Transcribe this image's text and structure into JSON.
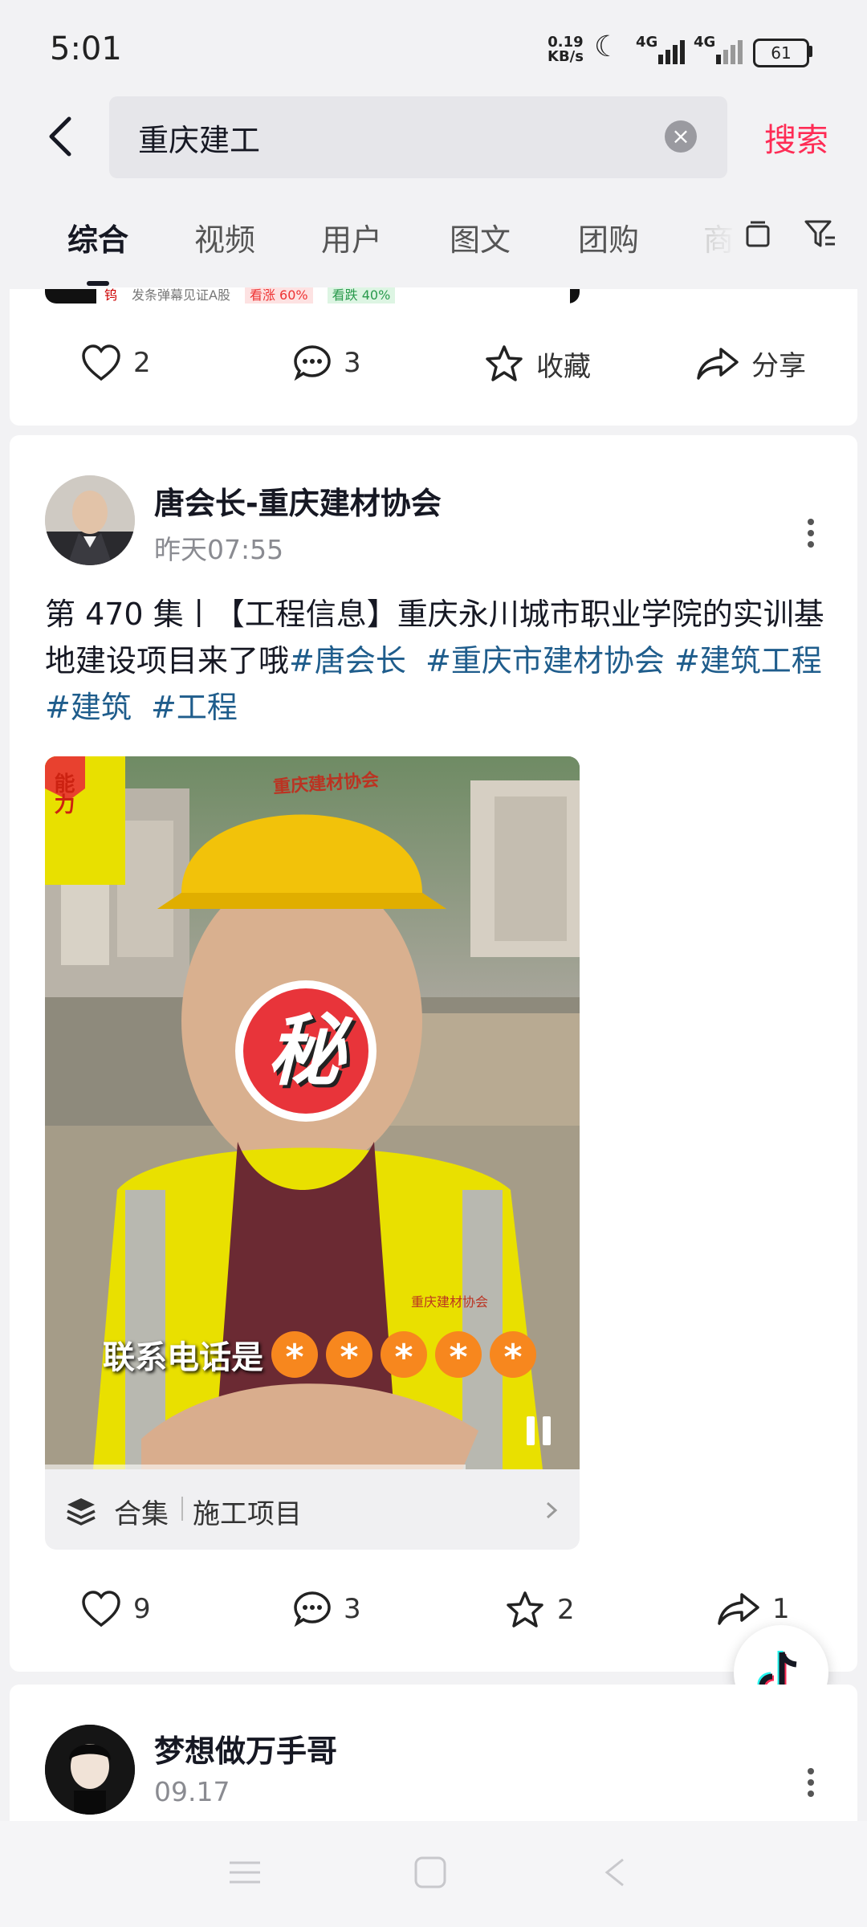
{
  "status_bar": {
    "time": "5:01",
    "net_speed_value": "0.19",
    "net_speed_unit": "KB/s",
    "signal1": "4G",
    "signal2": "4G",
    "battery": "61"
  },
  "search": {
    "query": "重庆建工",
    "search_label": "搜索"
  },
  "tabs": [
    {
      "label": "综合",
      "active": true
    },
    {
      "label": "视频"
    },
    {
      "label": "用户"
    },
    {
      "label": "图文"
    },
    {
      "label": "团购"
    },
    {
      "label": "商"
    }
  ],
  "prev_card": {
    "banner_text": "发条弹幕见证A股",
    "up_label": "看涨 60%",
    "down_label": "看跌 40%",
    "likes": "2",
    "comments": "3",
    "favorite_label": "收藏",
    "share_label": "分享"
  },
  "post": {
    "author": "唐会长-重庆建材协会",
    "time": "昨天07:55",
    "desc_prefix": "第 470 集丨【工程信息】重庆永川城市职业学院的实训基地建设项目来了哦",
    "hashtags": [
      "#唐会长",
      "#重庆市建材协会",
      "#建筑工程",
      "#建筑",
      "#工程"
    ],
    "video_corner_text": "能力",
    "helmet_text": "重庆建材协会",
    "vest_text": "重庆建材协会",
    "sticker_text": "秘",
    "caption": "联系电话是",
    "caption_masks": [
      "*",
      "*",
      "*",
      "*",
      "*"
    ],
    "collection_label": "合集",
    "collection_name": "施工项目",
    "likes": "9",
    "comments": "3",
    "favorites": "2",
    "shares": "1"
  },
  "next_post": {
    "author": "梦想做万手哥",
    "time": "09.17"
  },
  "colors": {
    "accent": "#fe2c55",
    "hashtag": "#1f5d8c",
    "background": "#f2f2f4"
  }
}
